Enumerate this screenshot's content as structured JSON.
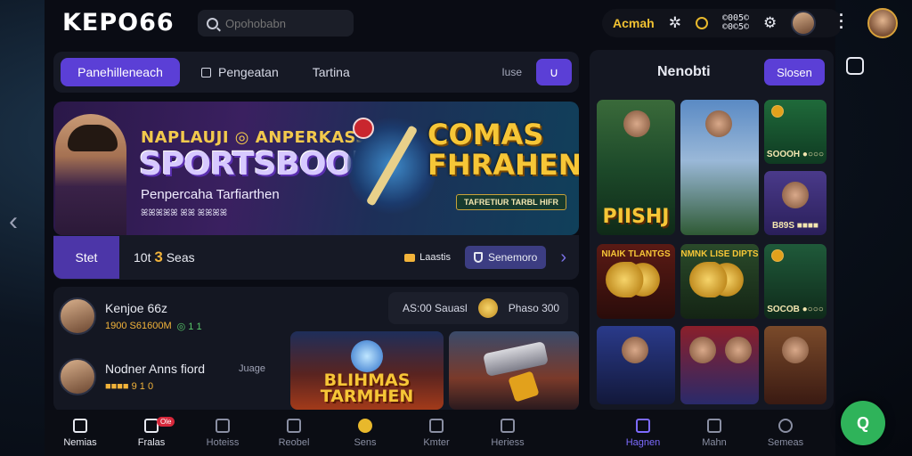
{
  "header": {
    "logo": "KEPO66",
    "search_placeholder": "Opohobabn",
    "account_name": "Acmah",
    "balance_lines": [
      "©005©",
      "©0©5©"
    ]
  },
  "tabs": {
    "items": [
      "Panehilleneach",
      "Pengeatan",
      "Tartina"
    ],
    "right_label": "Iuse"
  },
  "banner": {
    "tag": "NAPLAUJI ◎ ANPERKASSI ◎",
    "title": "SPORTSBOOK",
    "subtitle": "Penpercaha Tarfiarthen",
    "small": "ꕤꕤꕤꕤꕤ ꕤꕤ ꕤꕤꕤꕤ",
    "promo": "COMAS FHRAHEN",
    "promo_sub": "TAFRETIUR TARBL HIFR",
    "start": "Stet",
    "count_prefix": "10t",
    "count_num": "3",
    "count_suffix": "Seas",
    "pill_label": "Laastis",
    "button_label": "Senemoro"
  },
  "leaderboard": {
    "rows": [
      {
        "name": "Kenjoe 66z",
        "stat1": "1900 S61600M",
        "stat2": "◎ 1 1"
      },
      {
        "name": "Nodner Anns fiord",
        "stat1": "■■■■ 9 1 0",
        "stat2": ""
      }
    ],
    "right_text": "Juage",
    "bet_left": "AS:00 Sauasl",
    "bet_right": "Phaso 300",
    "tile1": "BLIHMAS TARMHEN",
    "tile2": ""
  },
  "right_panel": {
    "title": "Nenobti",
    "button": "Slosen",
    "tiles": [
      {
        "cap": ""
      },
      {
        "cap": ""
      },
      {
        "cap": "SOOOH ●○○○"
      },
      {
        "cap": "PIISHJ"
      },
      {
        "cap": "B89S ■■■■"
      },
      {
        "cap": "NIAIK TLANTGS"
      },
      {
        "cap": "NMNK LISE DIPTS"
      },
      {
        "cap": "SOCOB ●○○○"
      },
      {
        "cap": ""
      },
      {
        "cap": ""
      },
      {
        "cap": ""
      }
    ]
  },
  "bottom_nav": {
    "items": [
      "Nemias",
      "Fralas",
      "Hoteiss",
      "Reobel",
      "Sens",
      "Kmter",
      "Heriess",
      "Hagnen",
      "Mahn",
      "Semeas"
    ],
    "badge": "Ole"
  },
  "fab": "Q"
}
